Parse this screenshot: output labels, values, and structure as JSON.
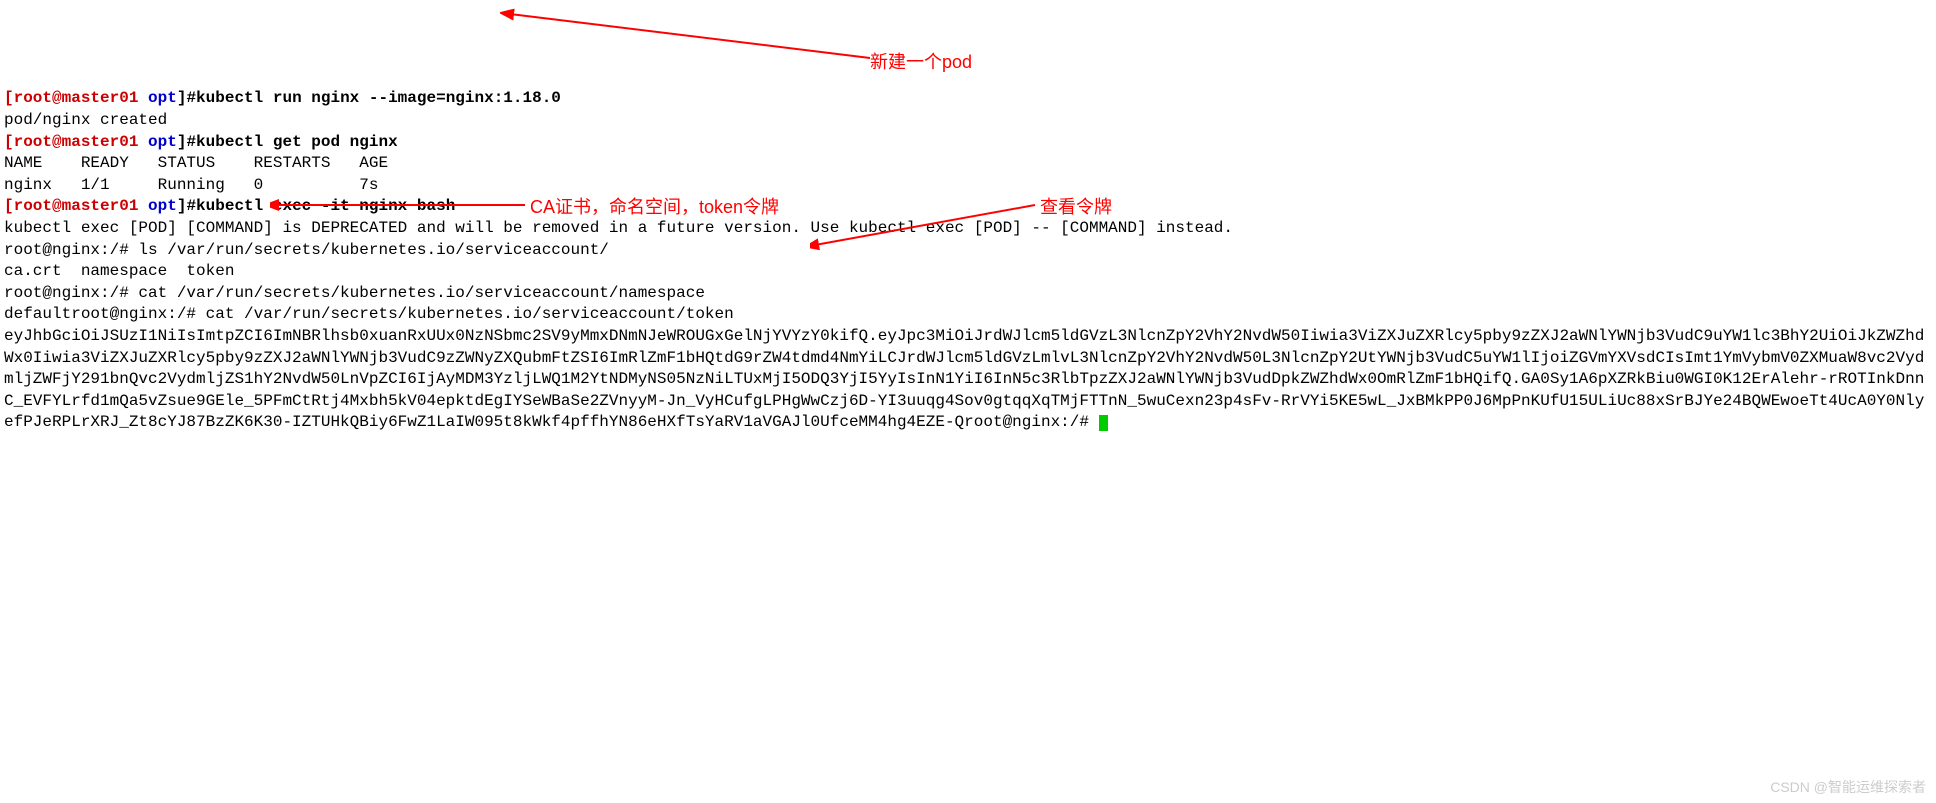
{
  "lines": {
    "l1_user": "[root@master01 ",
    "l1_path": "opt",
    "l1_sep": "]#",
    "l1_cmd": "kubectl run nginx --image=nginx:1.18.0",
    "l2_out": "pod/nginx created",
    "l3_user": "[root@master01 ",
    "l3_path": "opt",
    "l3_sep": "]#",
    "l3_cmd": "kubectl get pod nginx",
    "l4_out": "NAME    READY   STATUS    RESTARTS   AGE",
    "l5_out": "nginx   1/1     Running   0          7s",
    "l6_user": "[root@master01 ",
    "l6_path": "opt",
    "l6_sep": "]#",
    "l6_cmd": "kubectl exec -it nginx bash",
    "l7_out": "kubectl exec [POD] [COMMAND] is DEPRECATED and will be removed in a future version. Use kubectl exec [POD] -- [COMMAND] instead.",
    "l8_out": "root@nginx:/# ls /var/run/secrets/kubernetes.io/serviceaccount/",
    "l9_out": "ca.crt  namespace  token",
    "l10_out": "root@nginx:/# cat /var/run/secrets/kubernetes.io/serviceaccount/namespace",
    "l11_out": "defaultroot@nginx:/# cat /var/run/secrets/kubernetes.io/serviceaccount/token",
    "l12_out": "eyJhbGciOiJSUzI1NiIsImtpZCI6ImNBRlhsb0xuanRxUUx0NzNSbmc2SV9yMmxDNmNJeWROUGxGelNjYVYzY0kifQ.eyJpc3MiOiJrdWJlcm5ldGVzL3NlcnZpY2VhY2NvdW50Iiwia3ViZXJuZXRlcy5pby9zZXJ2aWNlYWNjb3VudC9uYW1lc3BhY2UiOiJkZWZhdWx0Iiwia3ViZXJuZXRlcy5pby9zZXJ2aWNlYWNjb3VudC9zZWNyZXQubmFtZSI6ImRlZmF1bHQtdG9rZW4tdmd4NmYiLCJrdWJlcm5ldGVzLmlvL3NlcnZpY2VhY2NvdW50L3NlcnZpY2UtYWNjb3VudC5uYW1lIjoiZGVmYXVsdCIsImt1YmVybmV0ZXMuaW8vc2VydmljZWFjY291bnQvc2VydmljZS1hY2NvdW50LnVpZCI6IjAyMDM3YzljLWQ1M2YtNDMyNS05NzNiLTUxMjI5ODQ3YjI5YyIsInN1YiI6InN5c3RlbTpzZXJ2aWNlYWNjb3VudDpkZWZhdWx0OmRlZmF1bHQifQ.GA0Sy1A6pXZRkBiu0WGI0K12ErAlehr-rROTInkDnnC_EVFYLrfd1mQa5vZsue9GEle_5PFmCtRtj4Mxbh5kV04epktdEgIYSeWBaSe2ZVnyyM-Jn_VyHCufgLPHgWwCzj6D-YI3uuqg4Sov0gtqqXqTMjFTTnN_5wuCexn23p4sFv-RrVYi5KE5wL_JxBMkPP0J6MpPnKUfU15ULiUc88xSrBJYe24BQWEwoeTt4UcA0Y0NlyefPJeRPLrXRJ_Zt8cYJ87BzZK6K30-IZTUHkQBiy6FwZ1LaIW095t8kWkf4pffhYN86eHXfTsYaRV1aVGAJl0UfceMM4hg4EZE-Qroot@nginx:/# "
  },
  "annotations": {
    "a1": "新建一个pod",
    "a2": "CA证书，命名空间，token令牌",
    "a3": "查看令牌"
  },
  "watermark": "CSDN @智能运维探索者"
}
